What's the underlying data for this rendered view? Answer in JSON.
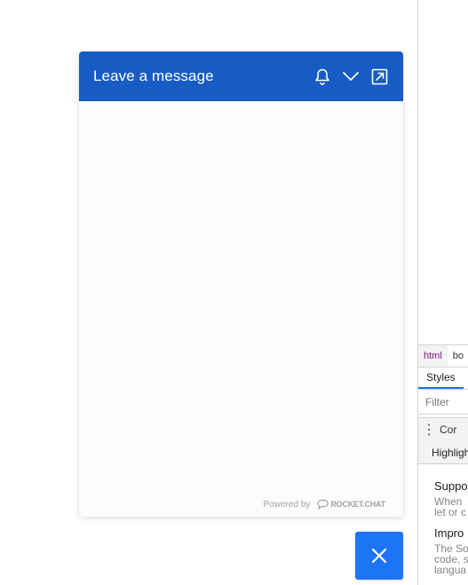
{
  "widget": {
    "title": "Leave a message",
    "powered_by": "Powered by",
    "brand": "ROCKET.CHAT",
    "icons": [
      "bell-icon",
      "chevron-down-icon",
      "popout-icon",
      "close-icon"
    ],
    "colors": {
      "header": "#175cc4",
      "fab": "#1d74f5"
    }
  },
  "devtools": {
    "breadcrumbs": [
      "html",
      "bo"
    ],
    "tab": "Styles",
    "filter_placeholder": "Filter",
    "console_label": "Cor",
    "highlight_label": "Highligh",
    "items": [
      {
        "title": "Suppo",
        "desc": [
          "When",
          "let or c"
        ]
      },
      {
        "title": "Impro",
        "desc": [
          "The So",
          "code, s",
          "langua"
        ]
      }
    ]
  }
}
